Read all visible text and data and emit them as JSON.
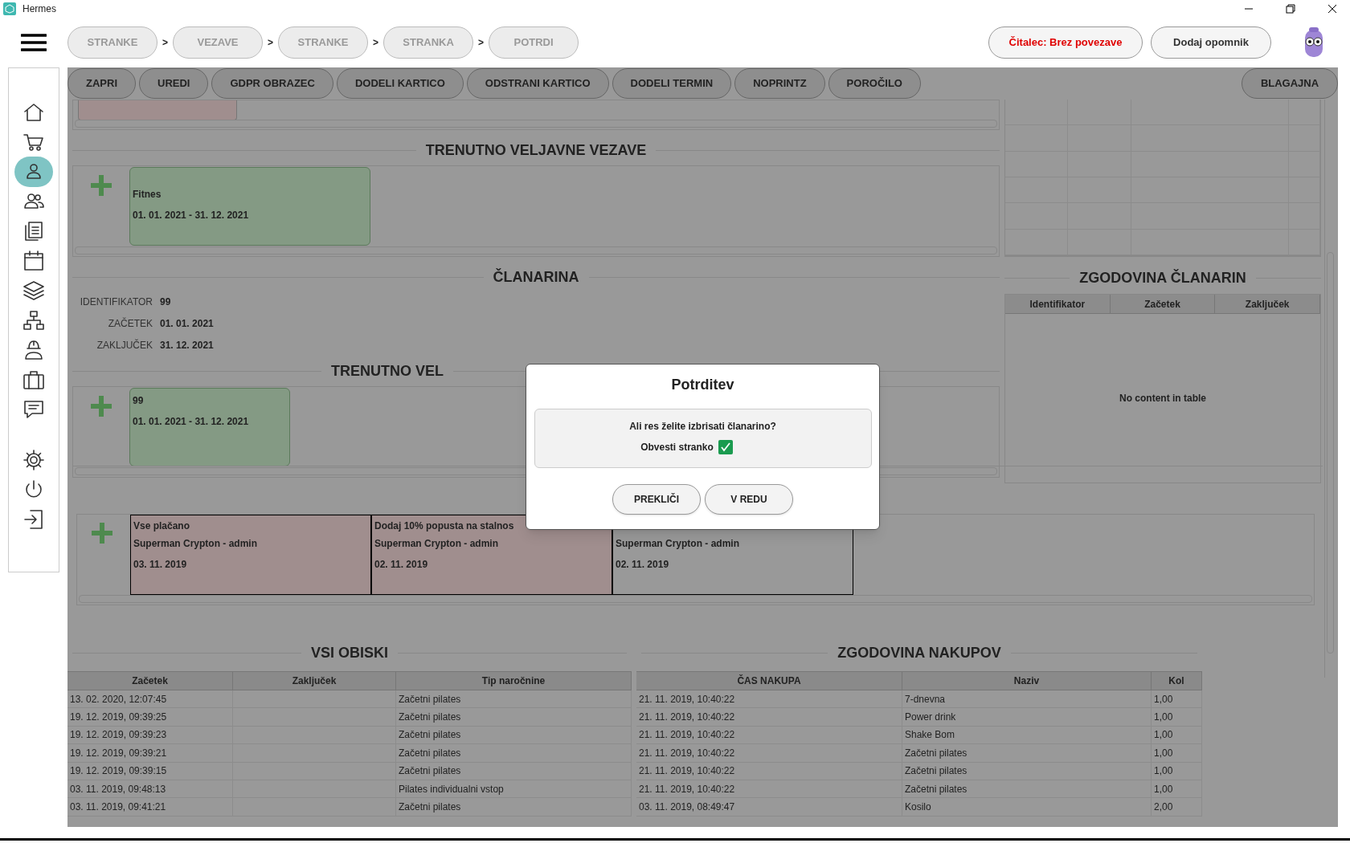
{
  "window": {
    "title": "Hermes"
  },
  "breadcrumbs": [
    {
      "label": "STRANKE"
    },
    {
      "separator": ">",
      "label": "VEZAVE"
    },
    {
      "separator": ">",
      "label": "STRANKE"
    },
    {
      "separator": ">",
      "label": "STRANKA"
    },
    {
      "separator": ">",
      "label": "POTRDI"
    }
  ],
  "reader_status": "Čitalec: Brez povezave",
  "reminder_button": "Dodaj opomnik",
  "sidebar": {
    "items": [
      {
        "kind": "home",
        "selected": false
      },
      {
        "kind": "cart",
        "selected": false
      },
      {
        "kind": "person",
        "selected": true
      },
      {
        "kind": "people",
        "selected": false
      },
      {
        "kind": "documents",
        "selected": false
      },
      {
        "kind": "calendar",
        "selected": false
      },
      {
        "kind": "layers",
        "selected": false
      },
      {
        "kind": "network",
        "selected": false
      },
      {
        "kind": "worker",
        "selected": false
      },
      {
        "kind": "briefcase",
        "selected": false
      },
      {
        "kind": "chat",
        "selected": false
      },
      {
        "kind": "settings",
        "selected": false
      },
      {
        "kind": "power",
        "selected": false
      },
      {
        "kind": "logout",
        "selected": false
      }
    ]
  },
  "toolbar": {
    "buttons": [
      "ZAPRI",
      "UREDI",
      "GDPR OBRAZEC",
      "DODELI KARTICO",
      "ODSTRANI KARTICO",
      "DODELI TERMIN",
      "NOPRINTZ",
      "POROČILO"
    ],
    "right_button": "BLAGAJNA"
  },
  "connections": {
    "title": "TRENUTNO VELJAVNE VEZAVE",
    "cards": [
      {
        "name": "Fitnes",
        "period": "01. 01. 2021 - 31. 12. 2021"
      }
    ]
  },
  "membership": {
    "title": "ČLANARINA",
    "fields": [
      {
        "label": "IDENTIFIKATOR",
        "value": "99"
      },
      {
        "label": "ZAČETEK",
        "value": "01. 01. 2021"
      },
      {
        "label": "ZAKLJUČEK",
        "value": "31. 12. 2021"
      }
    ]
  },
  "memberships": {
    "title": "TRENUTNO VEL",
    "cards": [
      {
        "name": "99",
        "period": "01. 01. 2021 - 31. 12. 2021"
      }
    ]
  },
  "notes": [
    {
      "text": "Vse plačano",
      "author": "Superman Crypton - admin",
      "date": "03. 11. 2019",
      "color": "#a08e8e"
    },
    {
      "text": "Dodaj 10% popusta na stalnos",
      "author": "Superman Crypton - admin",
      "date": "02. 11. 2019",
      "color": "#a08e8e"
    },
    {
      "author": "Superman Crypton - admin",
      "date": "02. 11. 2019",
      "color": "#999999"
    }
  ],
  "membership_history": {
    "title": "ZGODOVINA ČLANARIN",
    "columns": [
      "Identifikator",
      "Začetek",
      "Zaključek"
    ],
    "empty_text": "No content in table"
  },
  "visits": {
    "title": "VSI OBISKI",
    "columns": [
      "Začetek",
      "Zaključek",
      "Tip naročnine"
    ],
    "rows": [
      {
        "start": "13. 02. 2020, 12:07:45",
        "plan": "Začetni pilates"
      },
      {
        "start": "19. 12. 2019, 09:39:25",
        "plan": "Začetni pilates"
      },
      {
        "start": "19. 12. 2019, 09:39:23",
        "plan": "Začetni pilates"
      },
      {
        "start": "19. 12. 2019, 09:39:21",
        "plan": "Začetni pilates"
      },
      {
        "start": "19. 12. 2019, 09:39:15",
        "plan": "Začetni pilates"
      },
      {
        "start": "03. 11. 2019, 09:48:13",
        "plan": "Pilates individualni vstop"
      },
      {
        "start": "03. 11. 2019, 09:41:21",
        "plan": "Začetni pilates"
      }
    ]
  },
  "purchases": {
    "title": "ZGODOVINA NAKUPOV",
    "columns": [
      "ČAS NAKUPA",
      "Naziv",
      "Kol"
    ],
    "rows": [
      {
        "time": "21. 11. 2019, 10:40:22",
        "name": "7-dnevna",
        "qty": "1,00"
      },
      {
        "time": "21. 11. 2019, 10:40:22",
        "name": "Power drink",
        "qty": "1,00"
      },
      {
        "time": "21. 11. 2019, 10:40:22",
        "name": "Shake Bom",
        "qty": "1,00"
      },
      {
        "time": "21. 11. 2019, 10:40:22",
        "name": "Začetni pilates",
        "qty": "1,00"
      },
      {
        "time": "21. 11. 2019, 10:40:22",
        "name": "Začetni pilates",
        "qty": "1,00"
      },
      {
        "time": "21. 11. 2019, 10:40:22",
        "name": "Začetni pilates",
        "qty": "1,00"
      },
      {
        "time": "03. 11. 2019, 08:49:47",
        "name": "Kosilo",
        "qty": "2,00"
      }
    ]
  },
  "dialog": {
    "title": "Potrditev",
    "message": "Ali res želite izbrisati članarino?",
    "checkbox": {
      "label": "Obvesti stranko",
      "checked": true
    },
    "buttons": [
      "PREKLIČI",
      "V REDU"
    ]
  }
}
